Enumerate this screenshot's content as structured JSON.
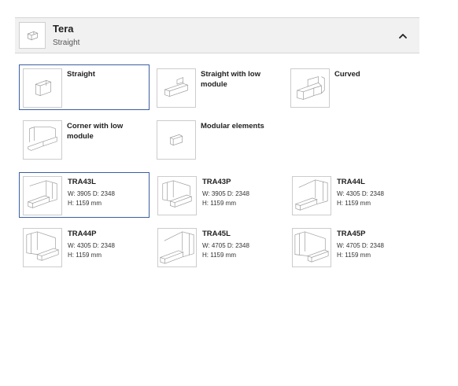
{
  "header": {
    "title": "Tera",
    "subtitle": "Straight",
    "thumb_icon": "straight-module-icon",
    "toggle_icon": "chevron-up-icon"
  },
  "types": [
    {
      "label": "Straight",
      "icon": "straight-icon",
      "selected": true
    },
    {
      "label": "Straight with low module",
      "icon": "straight-low-module-icon",
      "selected": false
    },
    {
      "label": "Curved",
      "icon": "curved-icon",
      "selected": false
    },
    {
      "label": "Corner with low module",
      "icon": "corner-low-module-icon",
      "selected": false
    },
    {
      "label": "Modular elements",
      "icon": "modular-elements-icon",
      "selected": false
    }
  ],
  "products": [
    {
      "name": "TRA43L",
      "dims": "W: 3905 D: 2348",
      "height": "H: 1159 mm",
      "selected": true
    },
    {
      "name": "TRA43P",
      "dims": "W: 3905 D: 2348",
      "height": "H: 1159 mm",
      "selected": false
    },
    {
      "name": "TRA44L",
      "dims": "W: 4305 D: 2348",
      "height": "H: 1159 mm",
      "selected": false
    },
    {
      "name": "TRA44P",
      "dims": "W: 4305 D: 2348",
      "height": "H: 1159 mm",
      "selected": false
    },
    {
      "name": "TRA45L",
      "dims": "W: 4705 D: 2348",
      "height": "H: 1159 mm",
      "selected": false
    },
    {
      "name": "TRA45P",
      "dims": "W: 4705 D: 2348",
      "height": "H: 1159 mm",
      "selected": false
    }
  ]
}
